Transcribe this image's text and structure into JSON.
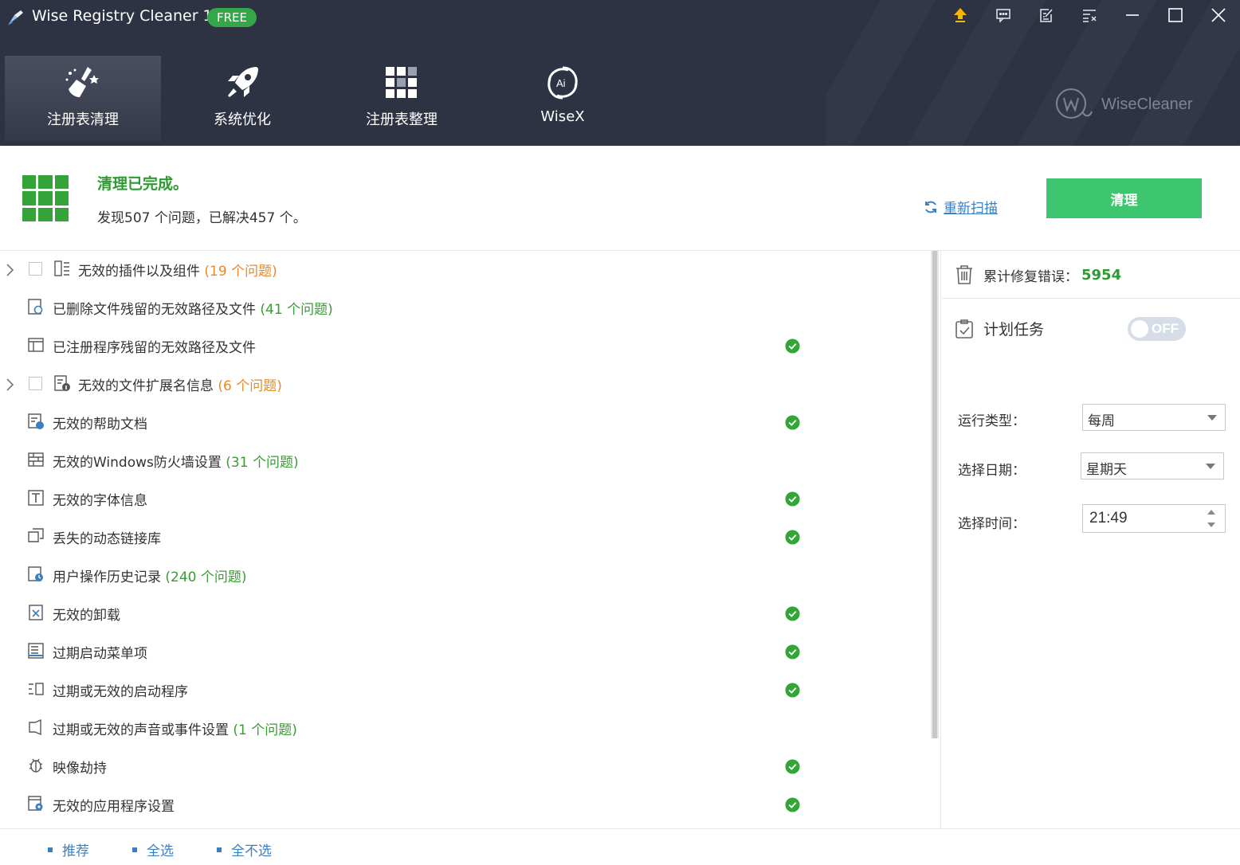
{
  "app": {
    "title": "Wise Registry Cleaner 11",
    "badge": "FREE"
  },
  "nav": [
    {
      "label": "注册表清理",
      "icon": "broom-icon",
      "active": true
    },
    {
      "label": "系统优化",
      "icon": "rocket-icon",
      "active": false
    },
    {
      "label": "注册表整理",
      "icon": "grid-blocks-icon",
      "active": false
    },
    {
      "label": "WiseX",
      "icon": "ai-swirl-icon",
      "active": false
    }
  ],
  "brand": {
    "text": "WiseCleaner"
  },
  "status": {
    "title": "清理已完成。",
    "summary": "发现507 个问题，已解决457 个。",
    "rescan_label": "重新扫描",
    "clean_label": "清理"
  },
  "items": [
    {
      "label": "无效的插件以及组件",
      "count": "(19 个问题)",
      "count_color": "orange",
      "expandable": true,
      "checkbox": true,
      "ok": false,
      "icon": "plugin-icon"
    },
    {
      "label": "已删除文件残留的无效路径及文件",
      "count": "(41 个问题)",
      "count_color": "green",
      "expandable": false,
      "checkbox": false,
      "ok": false,
      "icon": "file-search-icon"
    },
    {
      "label": "已注册程序残留的无效路径及文件",
      "count": "",
      "count_color": "",
      "expandable": false,
      "checkbox": false,
      "ok": true,
      "icon": "window-layout-icon"
    },
    {
      "label": "无效的文件扩展名信息",
      "count": "(6 个问题)",
      "count_color": "orange",
      "expandable": true,
      "checkbox": true,
      "ok": false,
      "icon": "file-info-icon"
    },
    {
      "label": "无效的帮助文档",
      "count": "",
      "count_color": "",
      "expandable": false,
      "checkbox": false,
      "ok": true,
      "icon": "help-doc-icon"
    },
    {
      "label": "无效的Windows防火墙设置",
      "count": "(31 个问题)",
      "count_color": "green",
      "expandable": false,
      "checkbox": false,
      "ok": false,
      "icon": "firewall-icon"
    },
    {
      "label": "无效的字体信息",
      "count": "",
      "count_color": "",
      "expandable": false,
      "checkbox": false,
      "ok": true,
      "icon": "font-icon"
    },
    {
      "label": "丢失的动态链接库",
      "count": "",
      "count_color": "",
      "expandable": false,
      "checkbox": false,
      "ok": true,
      "icon": "dll-icon"
    },
    {
      "label": "用户操作历史记录",
      "count": "(240 个问题)",
      "count_color": "green",
      "expandable": false,
      "checkbox": false,
      "ok": false,
      "icon": "history-icon"
    },
    {
      "label": "无效的卸载",
      "count": "",
      "count_color": "",
      "expandable": false,
      "checkbox": false,
      "ok": true,
      "icon": "uninstall-icon"
    },
    {
      "label": "过期启动菜单项",
      "count": "",
      "count_color": "",
      "expandable": false,
      "checkbox": false,
      "ok": true,
      "icon": "start-menu-icon"
    },
    {
      "label": "过期或无效的启动程序",
      "count": "",
      "count_color": "",
      "expandable": false,
      "checkbox": false,
      "ok": true,
      "icon": "startup-icon"
    },
    {
      "label": "过期或无效的声音或事件设置",
      "count": "(1 个问题)",
      "count_color": "green",
      "expandable": false,
      "checkbox": false,
      "ok": false,
      "icon": "sound-icon"
    },
    {
      "label": "映像劫持",
      "count": "",
      "count_color": "",
      "expandable": false,
      "checkbox": false,
      "ok": true,
      "icon": "bug-icon"
    },
    {
      "label": "无效的应用程序设置",
      "count": "",
      "count_color": "",
      "expandable": false,
      "checkbox": false,
      "ok": true,
      "icon": "app-settings-icon"
    }
  ],
  "right_panel": {
    "fixed_label": "累计修复错误：",
    "fixed_value": "5954",
    "task_label": "计划任务",
    "toggle_label": "OFF",
    "run_type_label": "运行类型：",
    "run_type_value": "每周",
    "date_label": "选择日期：",
    "date_value": "星期天",
    "time_label": "选择时间：",
    "time_value": "21:49"
  },
  "footer": {
    "recommend": "推荐",
    "select_all": "全选",
    "select_none": "全不选"
  },
  "colors": {
    "header_bg": "#2e3344",
    "green": "#34a33a",
    "clean_button": "#3dc56f",
    "link": "#3a7fc2",
    "orange": "#e58a2c",
    "free_badge": "#34a849"
  }
}
